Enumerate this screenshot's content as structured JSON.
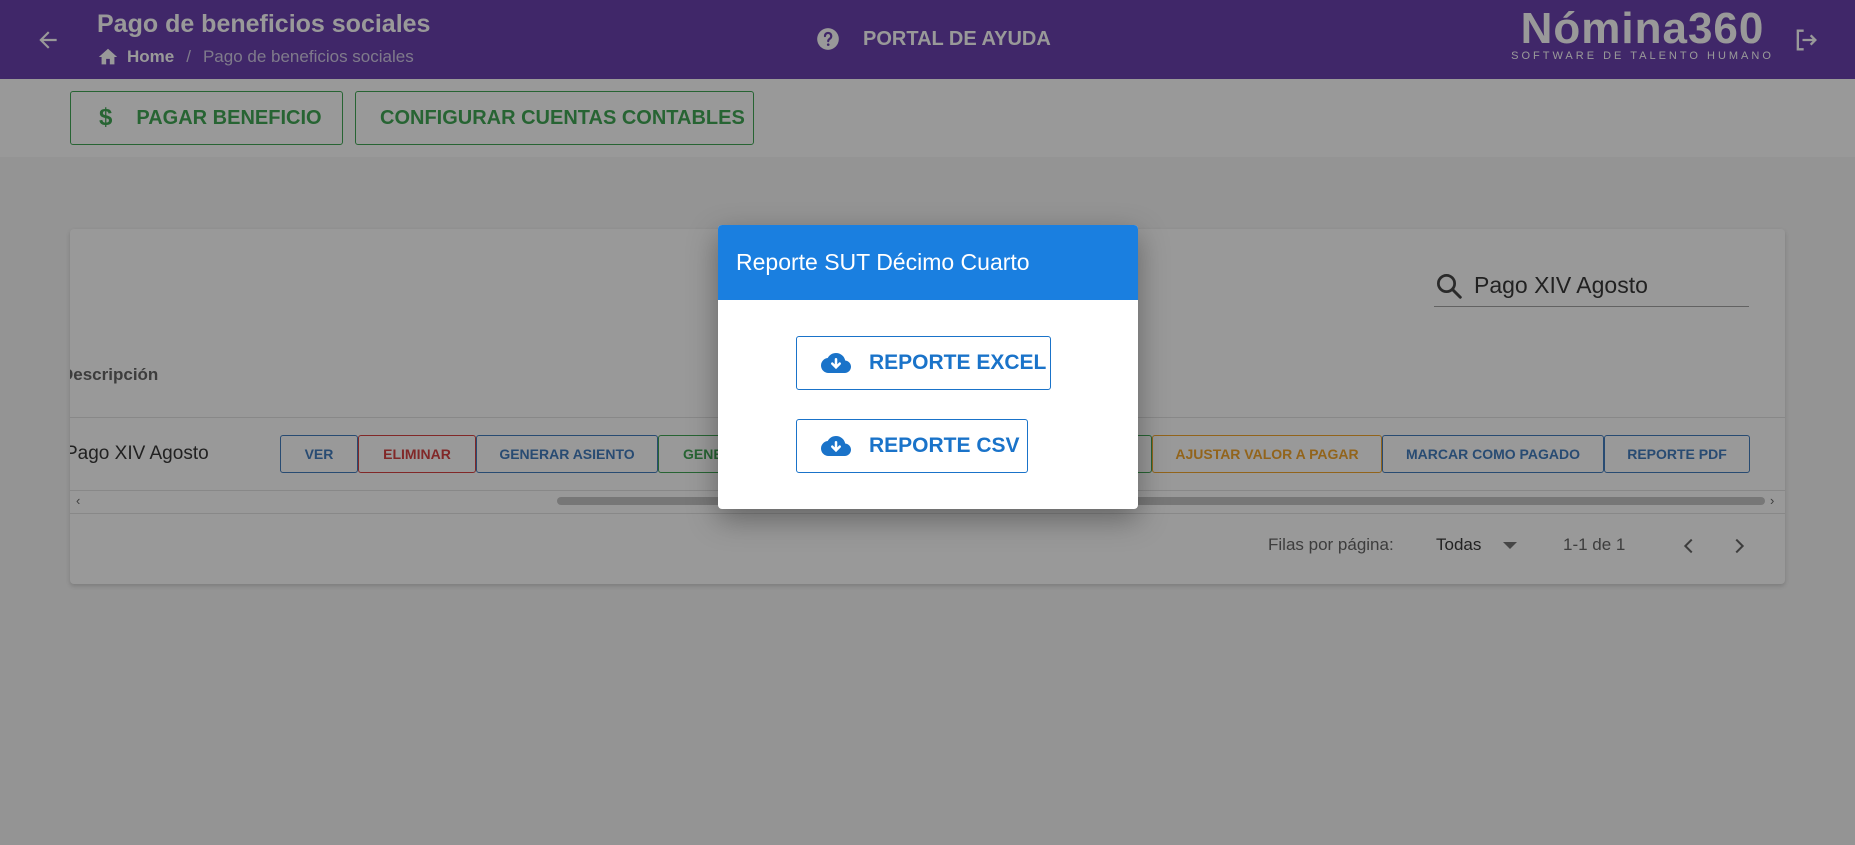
{
  "header": {
    "title": "Pago de beneficios sociales",
    "breadcrumb": {
      "home": "Home",
      "current": "Pago de beneficios sociales"
    },
    "help_label": "PORTAL DE AYUDA",
    "brand_name": "Nómina360",
    "brand_tagline": "SOFTWARE DE TALENTO HUMANO"
  },
  "toolbar": {
    "pay_label": "PAGAR BENEFICIO",
    "pay_symbol": "$",
    "config_label": "CONFIGURAR CUENTAS CONTABLES"
  },
  "table": {
    "search_value": "Pago XIV Agosto",
    "column_header": "Descripción",
    "row": {
      "description": "Pago XIV Agosto",
      "actions": {
        "ver": "VER",
        "eliminar": "ELIMINAR",
        "generar_asiento": "GENERAR ASIENTO",
        "gen_partial": "GENE",
        "ajustar": "AJUSTAR VALOR A PAGAR",
        "marcar": "MARCAR COMO PAGADO",
        "pdf": "REPORTE PDF"
      }
    },
    "scroll_left": "‹",
    "scroll_right": "›",
    "footer": {
      "rows_per_page_label": "Filas por página:",
      "rows_per_page_value": "Todas",
      "range": "1-1 de 1"
    }
  },
  "dialog": {
    "title": "Reporte SUT Décimo Cuarto",
    "excel_label": "REPORTE EXCEL",
    "csv_label": "REPORTE CSV"
  },
  "colors": {
    "header_bg": "#5b2ea6",
    "dialog_head": "#1a7fe0",
    "green": "#2e9e44",
    "blue": "#2f6fb8",
    "red": "#d32f2f",
    "orange": "#f29e17"
  }
}
